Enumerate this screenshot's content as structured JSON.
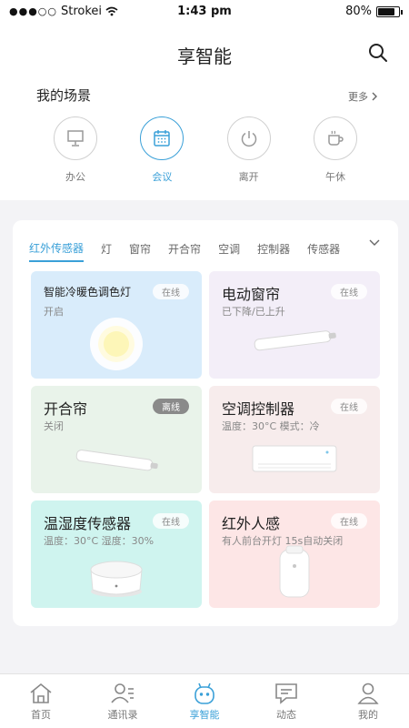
{
  "status_bar": {
    "signal": "●●●○○",
    "carrier": "Strokei",
    "time": "1:43 pm",
    "battery": "80%"
  },
  "header": {
    "title": "享智能"
  },
  "scenes": {
    "title": "我的场景",
    "more": "更多",
    "items": [
      {
        "label": "办公",
        "icon": "monitor-icon"
      },
      {
        "label": "会议",
        "icon": "calendar-icon",
        "active": true
      },
      {
        "label": "离开",
        "icon": "power-icon"
      },
      {
        "label": "午休",
        "icon": "coffee-cup-icon"
      }
    ]
  },
  "tabs": [
    "红外传感器",
    "灯",
    "窗帘",
    "开合帘",
    "空调",
    "控制器",
    "传感器"
  ],
  "devices": [
    {
      "name": "智能冷暖色调色灯",
      "status": "开启",
      "badge": "在线",
      "bg": "#d9ecfb"
    },
    {
      "name": "电动窗帘",
      "status": "已下降/已上升",
      "badge": "在线",
      "bg": "#f3eef8"
    },
    {
      "name": "开合帘",
      "status": "关闭",
      "badge": "离线",
      "bg": "#e9f3ea"
    },
    {
      "name": "空调控制器",
      "status": "温度：30°C  模式：冷",
      "badge": "在线",
      "bg": "#f7ecec"
    },
    {
      "name": "温湿度传感器",
      "status": "温度：30°C  湿度：30%",
      "badge": "在线",
      "bg": "#cff4ef"
    },
    {
      "name": "红外人感",
      "status": "有人前台开灯 15s自动关闭",
      "badge": "在线",
      "bg": "#fde6e6"
    }
  ],
  "bottom_nav": [
    {
      "label": "首页",
      "icon": "home-icon"
    },
    {
      "label": "通讯录",
      "icon": "contacts-icon"
    },
    {
      "label": "享智能",
      "icon": "robot-icon",
      "active": true
    },
    {
      "label": "动态",
      "icon": "message-icon"
    },
    {
      "label": "我的",
      "icon": "person-icon"
    }
  ],
  "colors": {
    "accent": "#3aa0d8",
    "offline_badge": "#8a8a8a"
  }
}
